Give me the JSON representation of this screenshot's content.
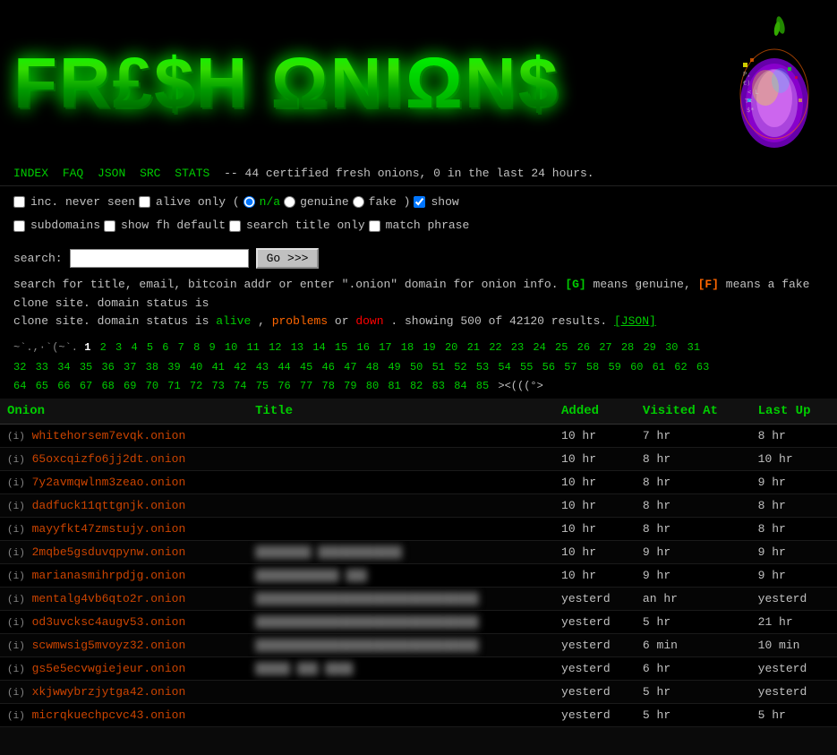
{
  "header": {
    "logo_text": "FR£$H ΩNiΩN$",
    "logo_display": "FRESH ONIONS"
  },
  "navbar": {
    "links": [
      {
        "label": "INDEX",
        "href": "#"
      },
      {
        "label": "FAQ",
        "href": "#"
      },
      {
        "label": "JSON",
        "href": "#"
      },
      {
        "label": "SRC",
        "href": "#"
      },
      {
        "label": "STATS",
        "href": "#"
      }
    ],
    "description": "-- 44 certified fresh onions, 0 in the last 24 hours."
  },
  "controls": {
    "inc_never_seen_label": "inc. never seen",
    "alive_only_label": "alive only (",
    "na_label": "n/a",
    "genuine_label": "genuine",
    "fake_label": "fake )",
    "show_label": "show",
    "subdomains_label": "subdomains",
    "show_fh_default_label": "show fh default",
    "search_title_only_label": "search title only",
    "match_phrase_label": "match phrase"
  },
  "search": {
    "label": "search:",
    "placeholder": "",
    "button_label": "Go >>>"
  },
  "info": {
    "text1": "search for title, email, bitcoin addr or enter \".onion\" domain for onion info.",
    "genuine_badge": "[G]",
    "genuine_desc": "means genuine,",
    "fake_badge": "[F]",
    "fake_desc": "means a fake clone site. domain status is",
    "status_alive": "alive",
    "status_comma": ",",
    "status_problems": "problems",
    "status_or": "or",
    "status_down": "down",
    "showing_text": ". showing 500 of 42120 results.",
    "json_link": "[JSON]"
  },
  "pagination": {
    "prefix": "~`.,·`(~`.",
    "current_page": "1",
    "pages": [
      "2",
      "3",
      "4",
      "5",
      "6",
      "7",
      "8",
      "9",
      "10",
      "11",
      "12",
      "13",
      "14",
      "15",
      "16",
      "17",
      "18",
      "19",
      "20",
      "21",
      "22",
      "23",
      "24",
      "25",
      "26",
      "27",
      "28",
      "29",
      "30",
      "31",
      "32",
      "33",
      "34",
      "35",
      "36",
      "37",
      "38",
      "39",
      "40",
      "41",
      "42",
      "43",
      "44",
      "45",
      "46",
      "47",
      "48",
      "49",
      "50",
      "51",
      "52",
      "53",
      "54",
      "55",
      "56",
      "57",
      "58",
      "59",
      "60",
      "61",
      "62",
      "63",
      "64",
      "65",
      "66",
      "67",
      "68",
      "69",
      "70",
      "71",
      "72",
      "73",
      "74",
      "75",
      "76",
      "77",
      "78",
      "79",
      "80",
      "81",
      "82",
      "83",
      "84",
      "85"
    ],
    "suffix": "><(((°>"
  },
  "table": {
    "headers": [
      "Onion",
      "Title",
      "Added",
      "Visited At",
      "Last Up"
    ],
    "rows": [
      {
        "info": "(i)",
        "onion": "whitehorsem7evqk.onion",
        "title": "",
        "blurred": true,
        "added": "10 hr",
        "visited": "7 hr",
        "last_up": "8 hr"
      },
      {
        "info": "(i)",
        "onion": "65oxcqizfo6jj2dt.onion",
        "title": "",
        "blurred": true,
        "added": "10 hr",
        "visited": "8 hr",
        "last_up": "10 hr"
      },
      {
        "info": "(i)",
        "onion": "7y2avmqwlnm3zeao.onion",
        "title": "",
        "blurred": true,
        "added": "10 hr",
        "visited": "8 hr",
        "last_up": "9 hr"
      },
      {
        "info": "(i)",
        "onion": "dadfuck11qttgnjk.onion",
        "title": "",
        "blurred": true,
        "added": "10 hr",
        "visited": "8 hr",
        "last_up": "8 hr"
      },
      {
        "info": "(i)",
        "onion": "mayyfkt47zmstujy.onion",
        "title": "",
        "blurred": true,
        "added": "10 hr",
        "visited": "8 hr",
        "last_up": "8 hr"
      },
      {
        "info": "(i)",
        "onion": "2mqbe5gsduvqpynw.onion",
        "title": "████████ ████████████",
        "blurred": true,
        "added": "10 hr",
        "visited": "9 hr",
        "last_up": "9 hr"
      },
      {
        "info": "(i)",
        "onion": "marianasmihrpdjg.onion",
        "title": "████████████ ███",
        "blurred": true,
        "added": "10 hr",
        "visited": "9 hr",
        "last_up": "9 hr"
      },
      {
        "info": "(i)",
        "onion": "mentalg4vb6qto2r.onion",
        "title": "████████████████████████████████",
        "blurred": true,
        "added": "yesterd",
        "visited": "an hr",
        "last_up": "yesterd"
      },
      {
        "info": "(i)",
        "onion": "od3uvcksc4augv53.onion",
        "title": "████████████████████████████████",
        "blurred": true,
        "added": "yesterd",
        "visited": "5 hr",
        "last_up": "21 hr"
      },
      {
        "info": "(i)",
        "onion": "scwmwsig5mvoyz32.onion",
        "title": "████████████████████████████████",
        "blurred": true,
        "added": "yesterd",
        "visited": "6 min",
        "last_up": "10 min"
      },
      {
        "info": "(i)",
        "onion": "gs5e5ecvwgiejeur.onion",
        "title": "█████ ███ ████",
        "blurred": true,
        "added": "yesterd",
        "visited": "6 hr",
        "last_up": "yesterd"
      },
      {
        "info": "(i)",
        "onion": "xkjwwybrzjytga42.onion",
        "title": "",
        "blurred": true,
        "added": "yesterd",
        "visited": "5 hr",
        "last_up": "yesterd"
      },
      {
        "info": "(i)",
        "onion": "micrqkuechpcvc43.onion",
        "title": "",
        "blurred": true,
        "added": "yesterd",
        "visited": "5 hr",
        "last_up": "5 hr"
      }
    ]
  },
  "colors": {
    "accent_green": "#00cc00",
    "link_orange": "#cc4400",
    "bg": "#000000",
    "text": "#c0c0c0"
  }
}
